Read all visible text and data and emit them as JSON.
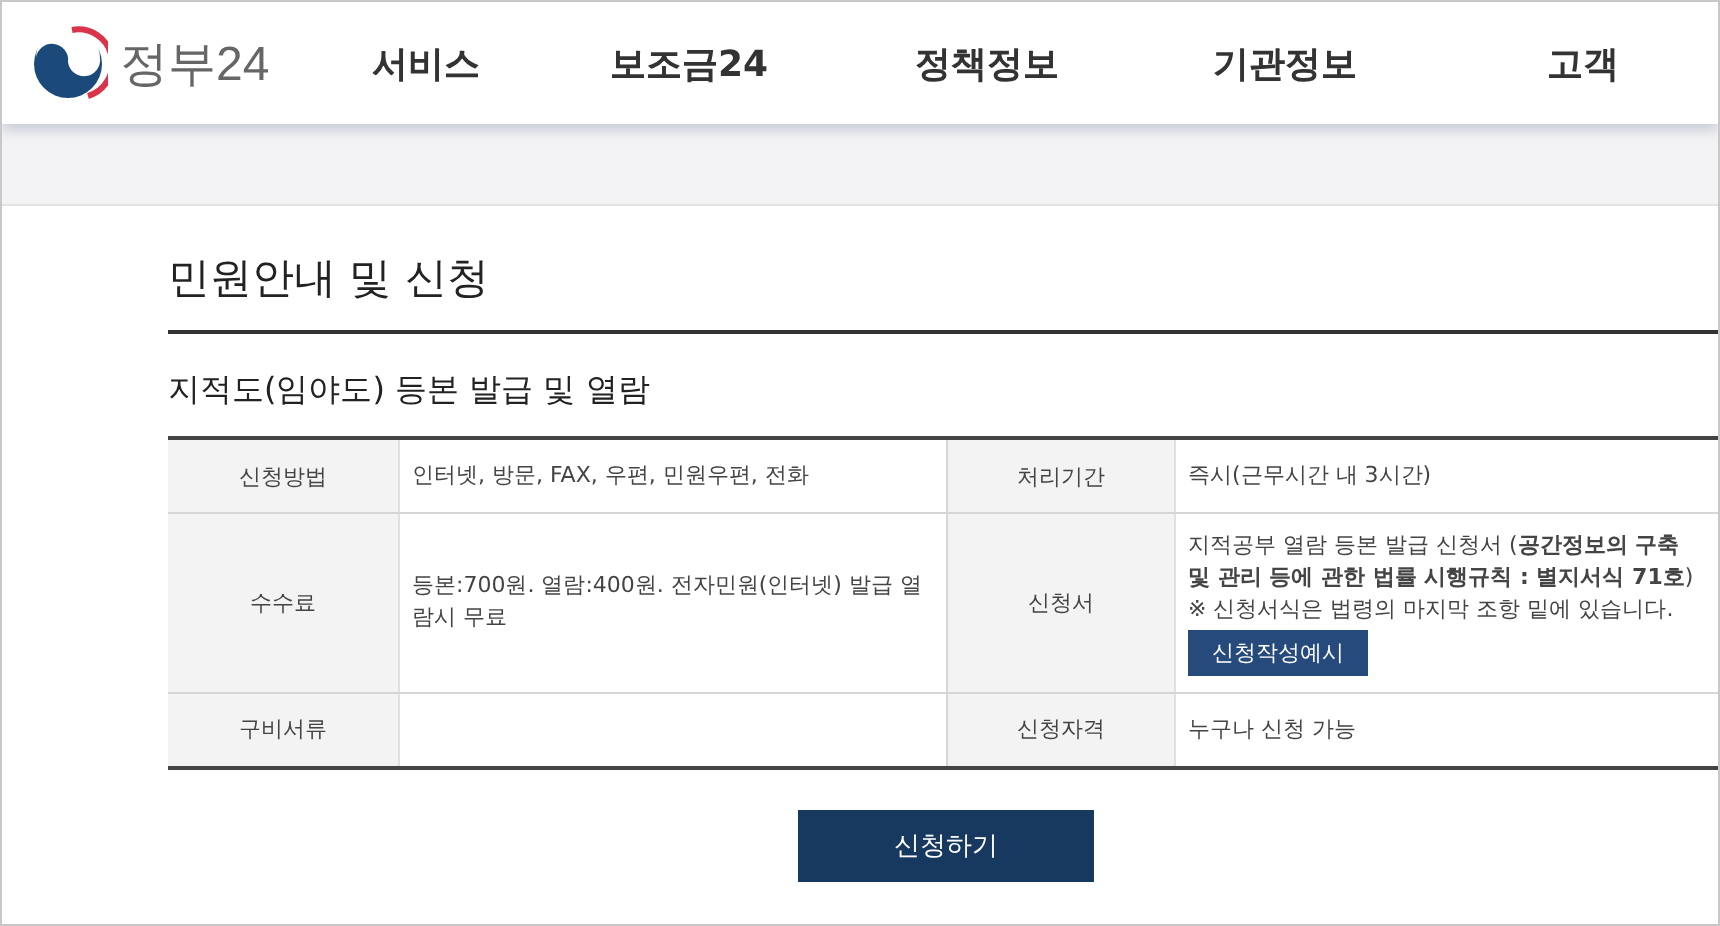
{
  "logo": {
    "text": "정부24"
  },
  "nav": [
    {
      "label": "서비스"
    },
    {
      "label": "보조금24"
    },
    {
      "label": "정책정보"
    },
    {
      "label": "기관정보"
    },
    {
      "label": "고객"
    }
  ],
  "page_title": "민원안내 및 신청",
  "section_title": "지적도(임야도) 등본 발급 및 열람",
  "table": {
    "rows": [
      {
        "cells": [
          {
            "label": "신청방법",
            "kind": "text",
            "value": "인터넷, 방문, FAX, 우편, 민원우편, 전화"
          },
          {
            "label": "처리기간",
            "kind": "text",
            "value": "즉시(근무시간 내 3시간)"
          }
        ]
      },
      {
        "cells": [
          {
            "label": "수수료",
            "kind": "text",
            "value": "등본:700원. 열람:400원. 전자민원(인터넷) 발급 열람시 무료"
          },
          {
            "label": "신청서",
            "kind": "form",
            "value": "지적공부 열람 등본 발급 신청서 (**공간정보의 구축 및 관리 등에 관한 법률 시행규칙 : 별지서식 71호**)",
            "note": "※ 신청서식은 법령의 마지막 조항 밑에 있습니다.",
            "button": "신청작성예시"
          }
        ]
      },
      {
        "cells": [
          {
            "label": "구비서류",
            "kind": "text"
          },
          {
            "label": "신청자격",
            "kind": "text",
            "value": "누구나 신청 가능"
          }
        ]
      }
    ]
  },
  "apply_button": "신청하기"
}
